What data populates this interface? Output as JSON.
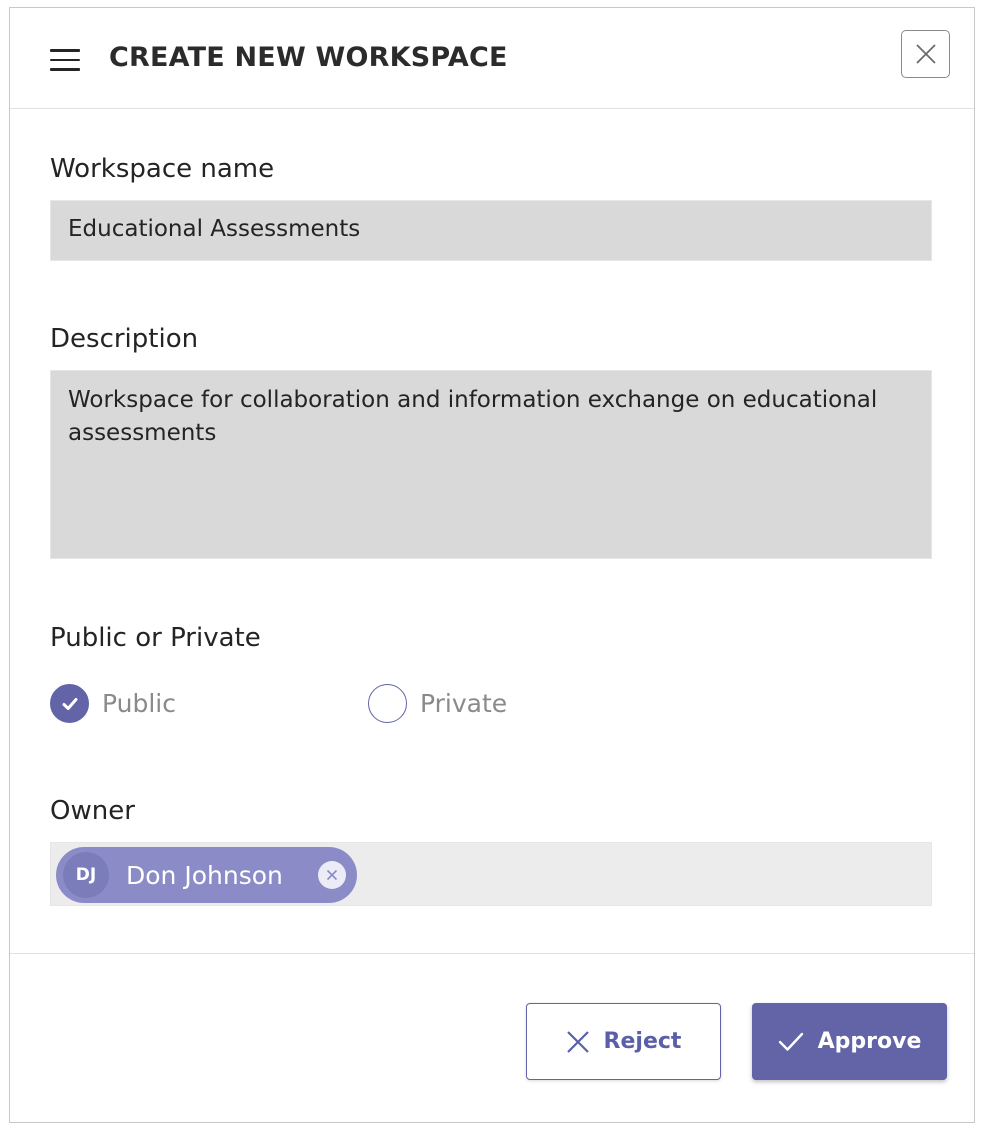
{
  "header": {
    "title": "CREATE NEW WORKSPACE",
    "menu_icon": "hamburger-menu-icon",
    "close_icon": "close-icon"
  },
  "form": {
    "workspace_name": {
      "label": "Workspace name",
      "value": "Educational Assessments"
    },
    "description": {
      "label": "Description",
      "value": "Workspace for collaboration and information exchange on educational assessments"
    },
    "visibility": {
      "label": "Public or Private",
      "options": [
        {
          "label": "Public",
          "selected": true
        },
        {
          "label": "Private",
          "selected": false
        }
      ]
    },
    "owner": {
      "label": "Owner",
      "chip": {
        "initials": "DJ",
        "name": "Don Johnson"
      }
    }
  },
  "footer": {
    "reject_label": "Reject",
    "approve_label": "Approve"
  },
  "colors": {
    "accent": "#6264a7",
    "chip": "#8b8cc7",
    "field_bg": "#d9d9d9"
  }
}
